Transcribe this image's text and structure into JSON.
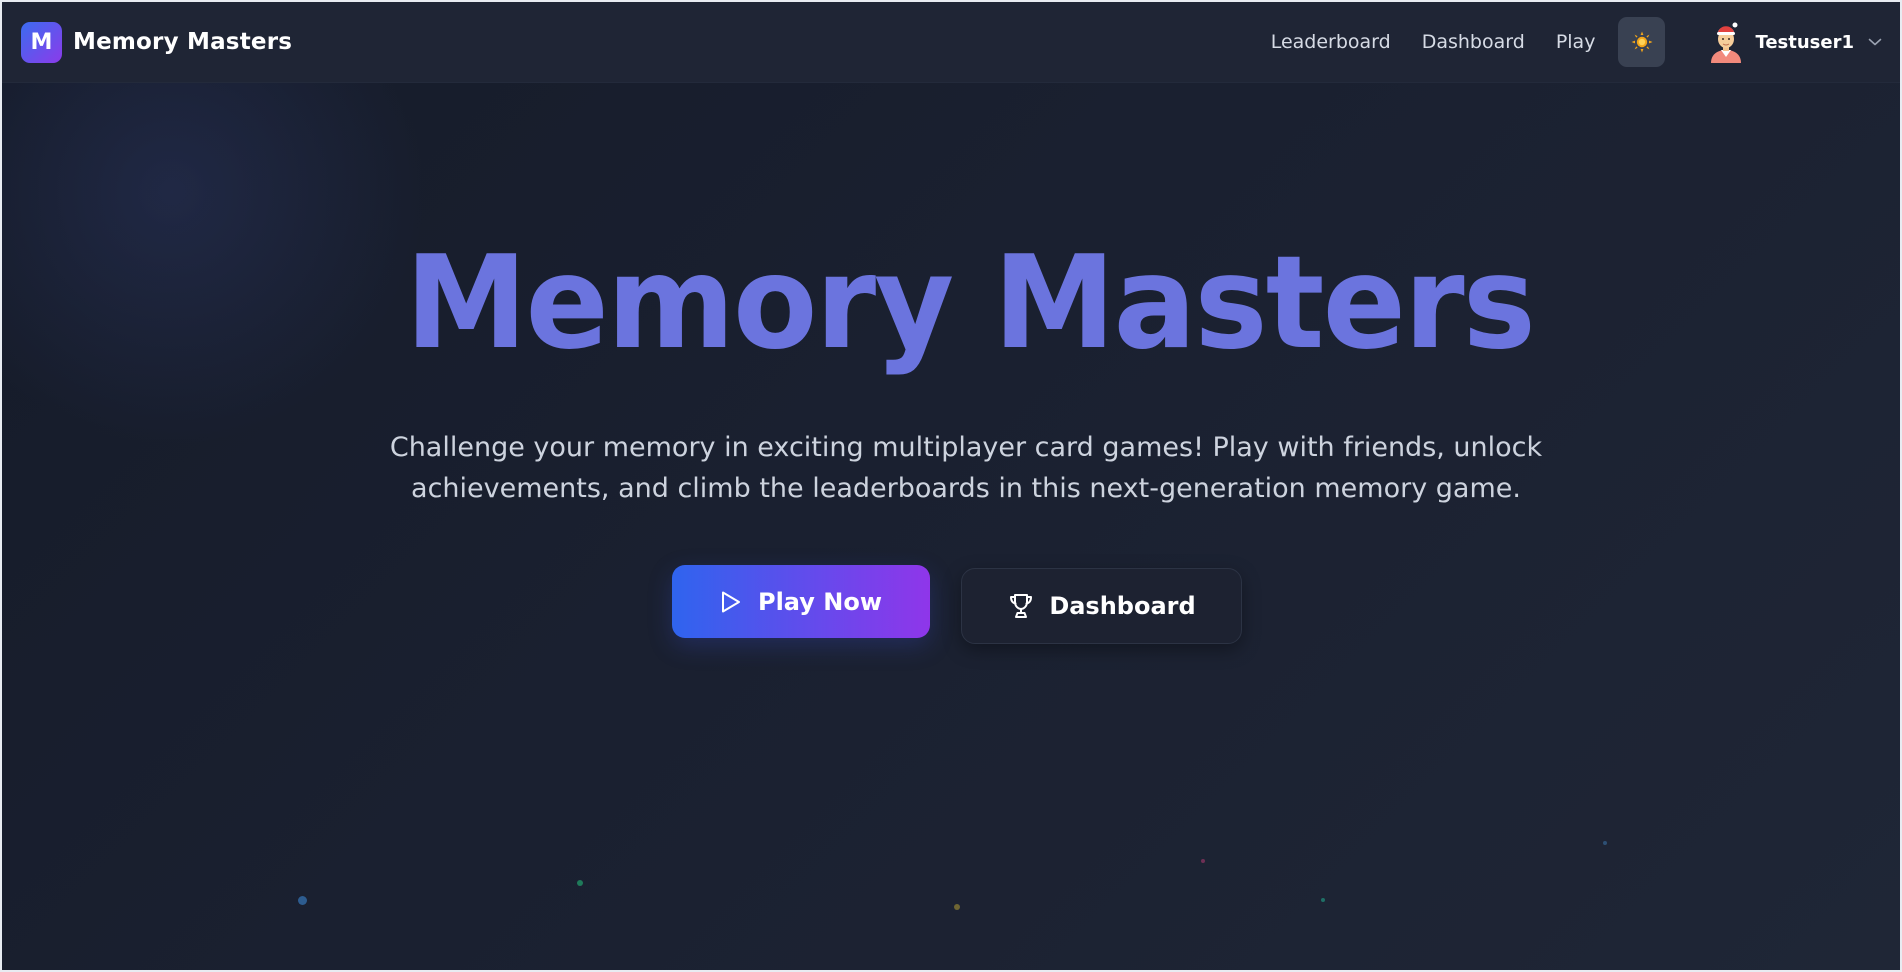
{
  "app": {
    "name": "Memory Masters",
    "logo_letter": "M"
  },
  "nav": {
    "links": [
      {
        "label": "Leaderboard"
      },
      {
        "label": "Dashboard"
      },
      {
        "label": "Play"
      }
    ],
    "theme_toggle_icon": "sun-icon",
    "user": {
      "name": "Testuser1",
      "avatar_icon": "avatar-icon",
      "menu_icon": "chevron-down-icon"
    }
  },
  "hero": {
    "title": "Memory Masters",
    "subtitle_line1": "Challenge your memory in exciting multiplayer card games! Play with friends, unlock",
    "subtitle_line2": "achievements, and climb the leaderboards in this next-generation memory game.",
    "primary_button": {
      "label": "Play Now",
      "icon": "play-icon"
    },
    "secondary_button": {
      "label": "Dashboard",
      "icon": "trophy-icon"
    }
  },
  "colors": {
    "background": "#1a2030",
    "navbar": "#1f2535",
    "title": "#6b74de",
    "accent_start": "#2f64ee",
    "accent_end": "#8f36ea"
  }
}
